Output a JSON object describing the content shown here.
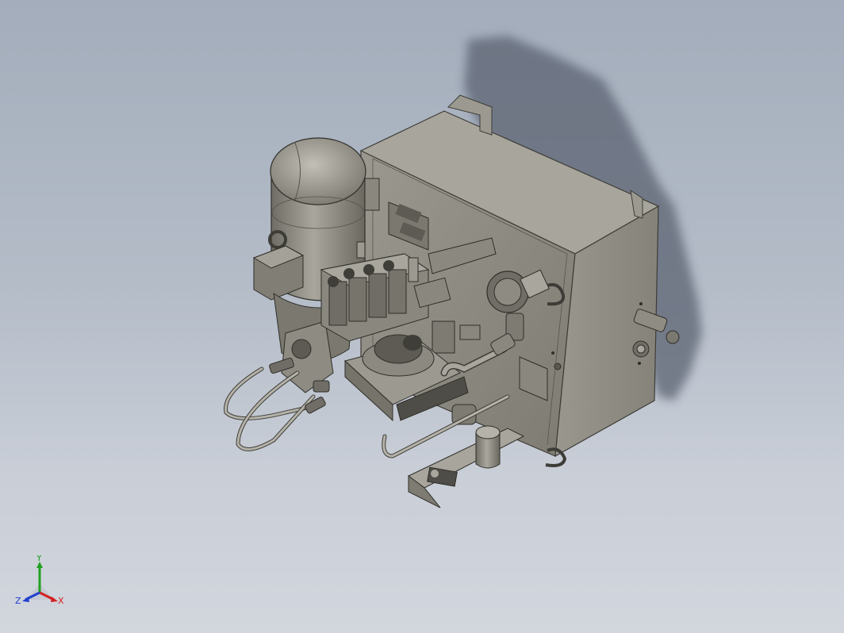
{
  "viewport": {
    "background_top": "#a3adbb",
    "background_bottom": "#d2d6dd",
    "model_color": "#8c8a80",
    "shadow_color": "#5b6472"
  },
  "triad": {
    "x_label": "X",
    "y_label": "Y",
    "z_label": "Z",
    "x_color": "#d42020",
    "y_color": "#20a020",
    "z_color": "#2040d0"
  }
}
